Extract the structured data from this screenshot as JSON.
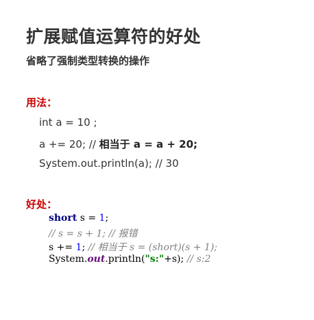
{
  "title": "扩展赋值运算符的好处",
  "subtitle": "省略了强制类型转换的操作",
  "usage": {
    "label": "用法：",
    "line1": "int a = 10 ;",
    "line2_code": "a += 20; // ",
    "line2_bold": "相当于 a = a + 20;",
    "line3": "System.out.println(a); // 30"
  },
  "benefit": {
    "label": "好处：",
    "code1": {
      "kw": "short",
      "rest": " s = ",
      "num": "1",
      "end": ";"
    },
    "code2": {
      "comment": "// s = s + 1; // 报错"
    },
    "code3": {
      "pre": "s += ",
      "num": "1",
      "mid": "; ",
      "comment": "// 相当于 s = (short)(s + 1);"
    },
    "code4": {
      "pre": "System.",
      "field": "out",
      "mid": ".println(",
      "str": "\"s:\"",
      "end": "+s); ",
      "comment": "// s:2"
    }
  }
}
